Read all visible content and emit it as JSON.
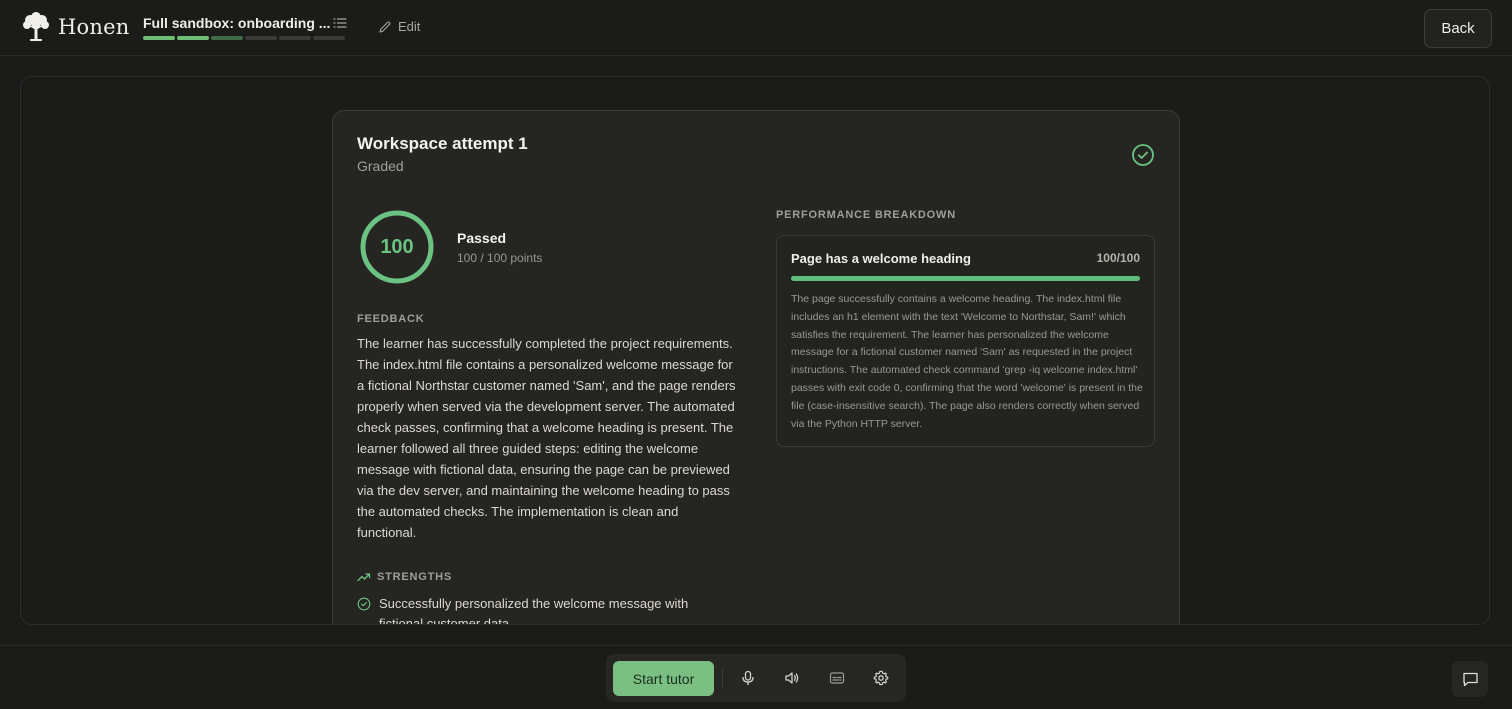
{
  "header": {
    "brand": "Honen",
    "course_title": "Full sandbox: onboarding ...",
    "progress_segments": [
      "done",
      "done",
      "partial",
      "todo",
      "todo",
      "todo"
    ],
    "edit_label": "Edit",
    "back_label": "Back"
  },
  "attempt": {
    "title": "Workspace attempt 1",
    "status": "Graded",
    "score": "100",
    "score_fraction": 1.0,
    "result_label": "Passed",
    "points": "100 / 100 points"
  },
  "feedback": {
    "label": "FEEDBACK",
    "text": "The learner has successfully completed the project requirements. The index.html file contains a personalized welcome message for a fictional Northstar customer named 'Sam', and the page renders properly when served via the development server. The automated check passes, confirming that a welcome heading is present. The learner followed all three guided steps: editing the welcome message with fictional data, ensuring the page can be previewed via the dev server, and maintaining the welcome heading to pass the automated checks. The implementation is clean and functional."
  },
  "strengths": {
    "label": "STRENGTHS",
    "items": [
      "Successfully personalized the welcome message with fictional customer data"
    ]
  },
  "performance": {
    "label": "PERFORMANCE BREAKDOWN",
    "items": [
      {
        "title": "Page has a welcome heading",
        "score": "100/100",
        "fraction": 1.0,
        "description": "The page successfully contains a welcome heading. The index.html file includes an h1 element with the text 'Welcome to Northstar, Sam!' which satisfies the requirement. The learner has personalized the welcome message for a fictional customer named 'Sam' as requested in the project instructions. The automated check command 'grep -iq welcome index.html' passes with exit code 0, confirming that the word 'welcome' is present in the file (case-insensitive search). The page also renders correctly when served via the Python HTTP server."
      }
    ]
  },
  "toolbar": {
    "start_tutor_label": "Start tutor",
    "icons": [
      "microphone-icon",
      "speaker-icon",
      "captions-icon",
      "gear-icon"
    ],
    "chat_icon": "chat-icon"
  },
  "colors": {
    "accent": "#6cc283",
    "progress_done": "#6fbf79",
    "button_green": "#7cbf83"
  }
}
